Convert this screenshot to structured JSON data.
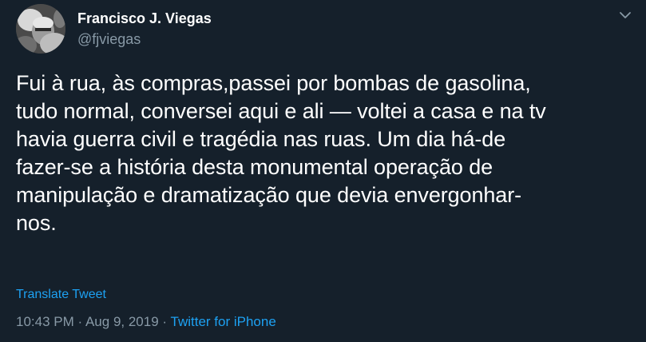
{
  "author": {
    "name": "Francisco J. Viegas",
    "handle": "@fjviegas"
  },
  "tweet": {
    "text_lines": [
      "Fui à rua, às compras,passei por bombas de gasolina,",
      "tudo normal, conversei aqui e ali — voltei a casa e na tv",
      "havia guerra civil e tragédia nas ruas. Um dia há-de",
      "fazer-se a história desta monumental operação de",
      "manipulação e dramatização que devia envergonhar-",
      "nos."
    ],
    "translate_label": "Translate Tweet",
    "time": "10:43 PM",
    "separator": "·",
    "date": "Aug 9, 2019",
    "source": "Twitter for iPhone"
  },
  "icons": {
    "menu": "chevron-down-icon",
    "avatar": "avatar"
  },
  "colors": {
    "background": "#15202b",
    "text": "#ffffff",
    "secondary": "#8899a6",
    "link": "#1da1f2"
  }
}
